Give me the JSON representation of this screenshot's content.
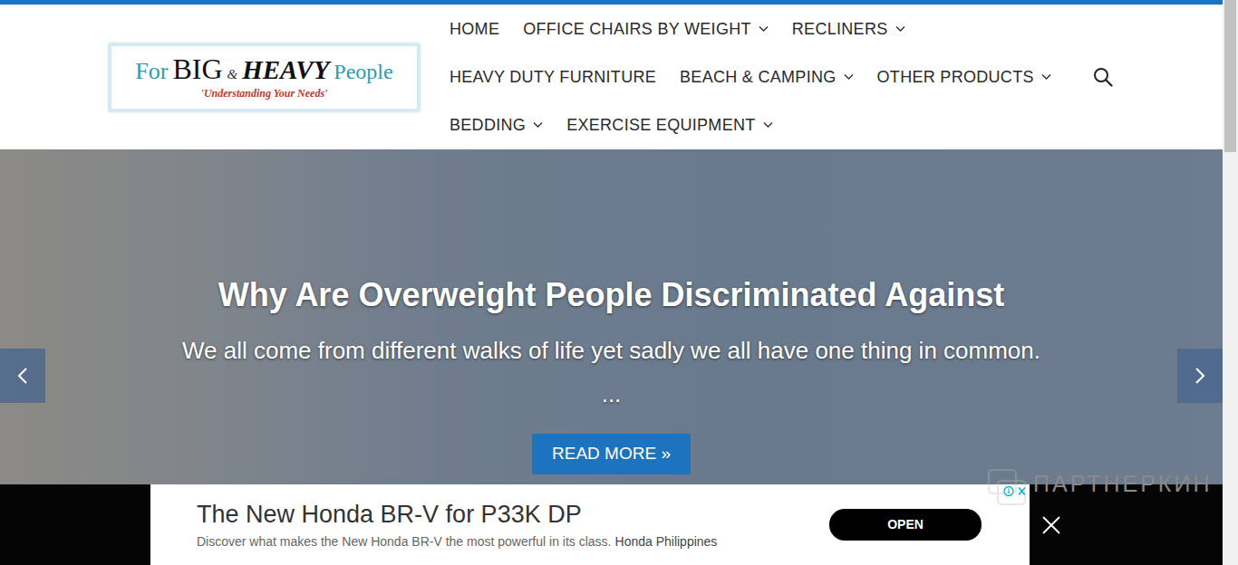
{
  "logo": {
    "for": "For",
    "big": "BIG",
    "amp": "&",
    "heavy": "HEAVY",
    "people": "People",
    "tagline": "'Understanding Your Needs'"
  },
  "nav": {
    "items": [
      {
        "label": "HOME",
        "dropdown": false
      },
      {
        "label": "OFFICE CHAIRS BY WEIGHT",
        "dropdown": true
      },
      {
        "label": "RECLINERS",
        "dropdown": true
      },
      {
        "label": "HEAVY DUTY FURNITURE",
        "dropdown": false
      },
      {
        "label": "BEACH & CAMPING",
        "dropdown": true
      },
      {
        "label": "OTHER PRODUCTS",
        "dropdown": true
      },
      {
        "label": "BEDDING",
        "dropdown": true
      },
      {
        "label": "EXERCISE EQUIPMENT",
        "dropdown": true
      }
    ]
  },
  "hero": {
    "title": "Why Are Overweight People Discriminated Against",
    "excerpt": "We all come from different walks of life yet sadly we all have one thing in common.",
    "more": "...",
    "button": "READ MORE »"
  },
  "ad": {
    "headline": "The New Honda BR-V for P33K DP",
    "description": "Discover what makes the New Honda BR-V the most powerful in its class.",
    "advertiser": "Honda Philippines",
    "button": "OPEN"
  },
  "watermark": "ПАРТНЕРКИН",
  "scrollbar": {
    "offset": 0,
    "thumb": 0.27
  }
}
